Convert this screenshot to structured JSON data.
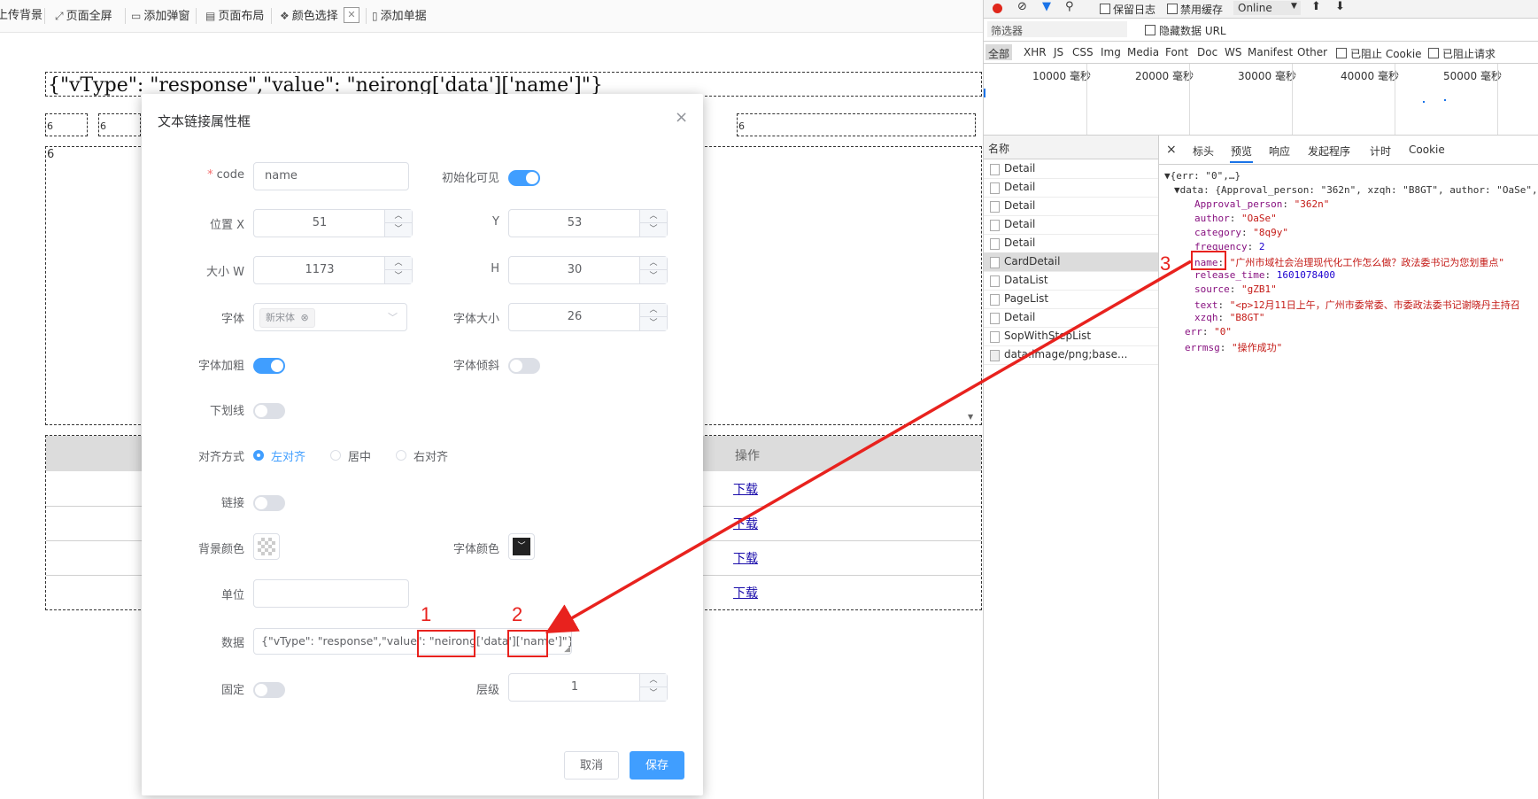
{
  "toolbar": {
    "items": [
      "上传背景",
      "页面全屏",
      "添加弹窗",
      "页面布局",
      "颜色选择",
      "添加单据"
    ]
  },
  "canvas": {
    "big_text": "{\"vType\": \"response\",\"value\": \"neirong['data']['name']\"}",
    "small_num": "6",
    "table_header_action": "操作",
    "download_link": "下载"
  },
  "modal": {
    "title": "文本链接属性框",
    "code_label": "code",
    "code_value": "name",
    "visible_label": "初始化可见",
    "posx_label": "位置 X",
    "posx_value": "51",
    "y_label": "Y",
    "y_value": "53",
    "sizew_label": "大小 W",
    "sizew_value": "1173",
    "h_label": "H",
    "h_value": "30",
    "font_label": "字体",
    "font_tag": "新宋体",
    "fontsize_label": "字体大小",
    "fontsize_value": "26",
    "bold_label": "字体加粗",
    "italic_label": "字体倾斜",
    "underline_label": "下划线",
    "align_label": "对齐方式",
    "align_options": [
      "左对齐",
      "居中",
      "右对齐"
    ],
    "link_label": "链接",
    "bgcolor_label": "背景颜色",
    "fontcolor_label": "字体颜色",
    "unit_label": "单位",
    "unit_value": "",
    "data_label": "数据",
    "data_value": "{\"vType\": \"response\",\"value\": \"neirong['data']['name']\"}",
    "fixed_label": "固定",
    "layer_label": "层级",
    "layer_value": "1",
    "cancel": "取消",
    "save": "保存"
  },
  "devtools": {
    "throttle": "Online",
    "keep_log": "保留日志",
    "disable_cache": "禁用缓存",
    "filter_placeholder": "筛选器",
    "hide_data_url": "隐藏数据 URL",
    "types": [
      "全部",
      "XHR",
      "JS",
      "CSS",
      "Img",
      "Media",
      "Font",
      "Doc",
      "WS",
      "Manifest",
      "Other"
    ],
    "blocked_cookie": "已阻止 Cookie",
    "blocked_requests": "已阻止请求",
    "timeline": [
      "10000 毫秒",
      "20000 毫秒",
      "30000 毫秒",
      "40000 毫秒",
      "50000 毫秒"
    ],
    "name_header": "名称",
    "requests": [
      "Detail",
      "Detail",
      "Detail",
      "Detail",
      "Detail",
      "CardDetail",
      "DataList",
      "PageList",
      "Detail",
      "SopWithStepList",
      "data:image/png;base..."
    ],
    "tabs": [
      "标头",
      "预览",
      "响应",
      "发起程序",
      "计时",
      "Cookie"
    ],
    "preview": {
      "root": "{err: \"0\",…}",
      "data_summary": "data: {Approval_person: \"362n\", xzqh: \"B8GT\", author: \"OaSe\",",
      "approval_key": "Approval_person",
      "approval_val": "\"362n\"",
      "author_key": "author",
      "author_val": "\"OaSe\"",
      "category_key": "category",
      "category_val": "\"8q9y\"",
      "frequency_key": "frequency",
      "frequency_val": "2",
      "name_key": "name",
      "name_val": "\"广州市域社会治理现代化工作怎么做？政法委书记为您划重点\"",
      "release_key": "release_time",
      "release_val": "1601078400",
      "source_key": "source",
      "source_val": "\"gZB1\"",
      "text_key": "text",
      "text_val": "\"<p>12月11日上午，广州市委常委、市委政法委书记谢晓丹主持召",
      "xzqh_key": "xzqh",
      "xzqh_val": "\"B8GT\"",
      "err_key": "err",
      "err_val": "\"0\"",
      "errmsg_key": "errmsg",
      "errmsg_val": "\"操作成功\""
    }
  },
  "annotations": [
    "1",
    "2",
    "3"
  ],
  "colors": {
    "accent": "#409eff",
    "annotation": "#e8221e"
  }
}
